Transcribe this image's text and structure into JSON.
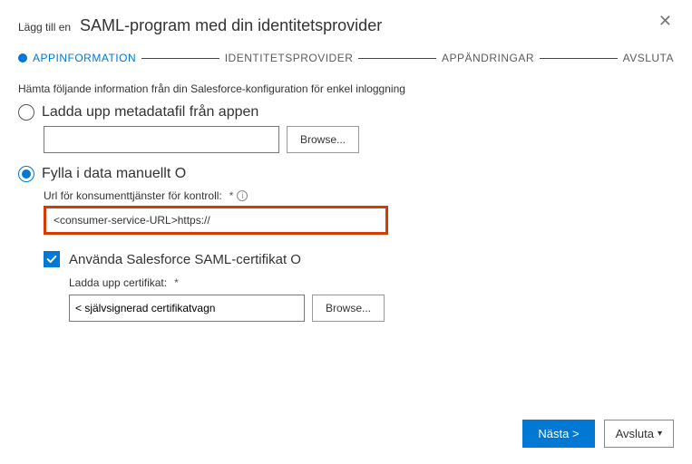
{
  "close_glyph": "✕",
  "header": {
    "pre": "Lägg till en",
    "title": "SAML-program med din identitetsprovider"
  },
  "stepper": {
    "s1": "APPINFORMATION",
    "s2": "IDENTITETSPROVIDER",
    "s3": "APPÄNDRINGAR",
    "s4": "AVSLUTA"
  },
  "instruction": "Hämta följande information från din Salesforce-konfiguration för enkel inloggning",
  "option_upload": {
    "label": "Ladda upp metadatafil från appen",
    "browse": "Browse..."
  },
  "option_manual": {
    "label": "Fylla i data manuellt O",
    "url_label": "Url för konsumenttjänster för kontroll:",
    "url_value": "<consumer-service-URL>https://",
    "use_cert_label": "Använda Salesforce SAML-certifikat O",
    "upload_cert_label": "Ladda upp certifikat:",
    "cert_value": "< självsignerad certifikatvagn",
    "cert_browse": "Browse..."
  },
  "footer": {
    "next": "Nästa >",
    "cancel": "Avsluta"
  },
  "info_glyph": "i"
}
